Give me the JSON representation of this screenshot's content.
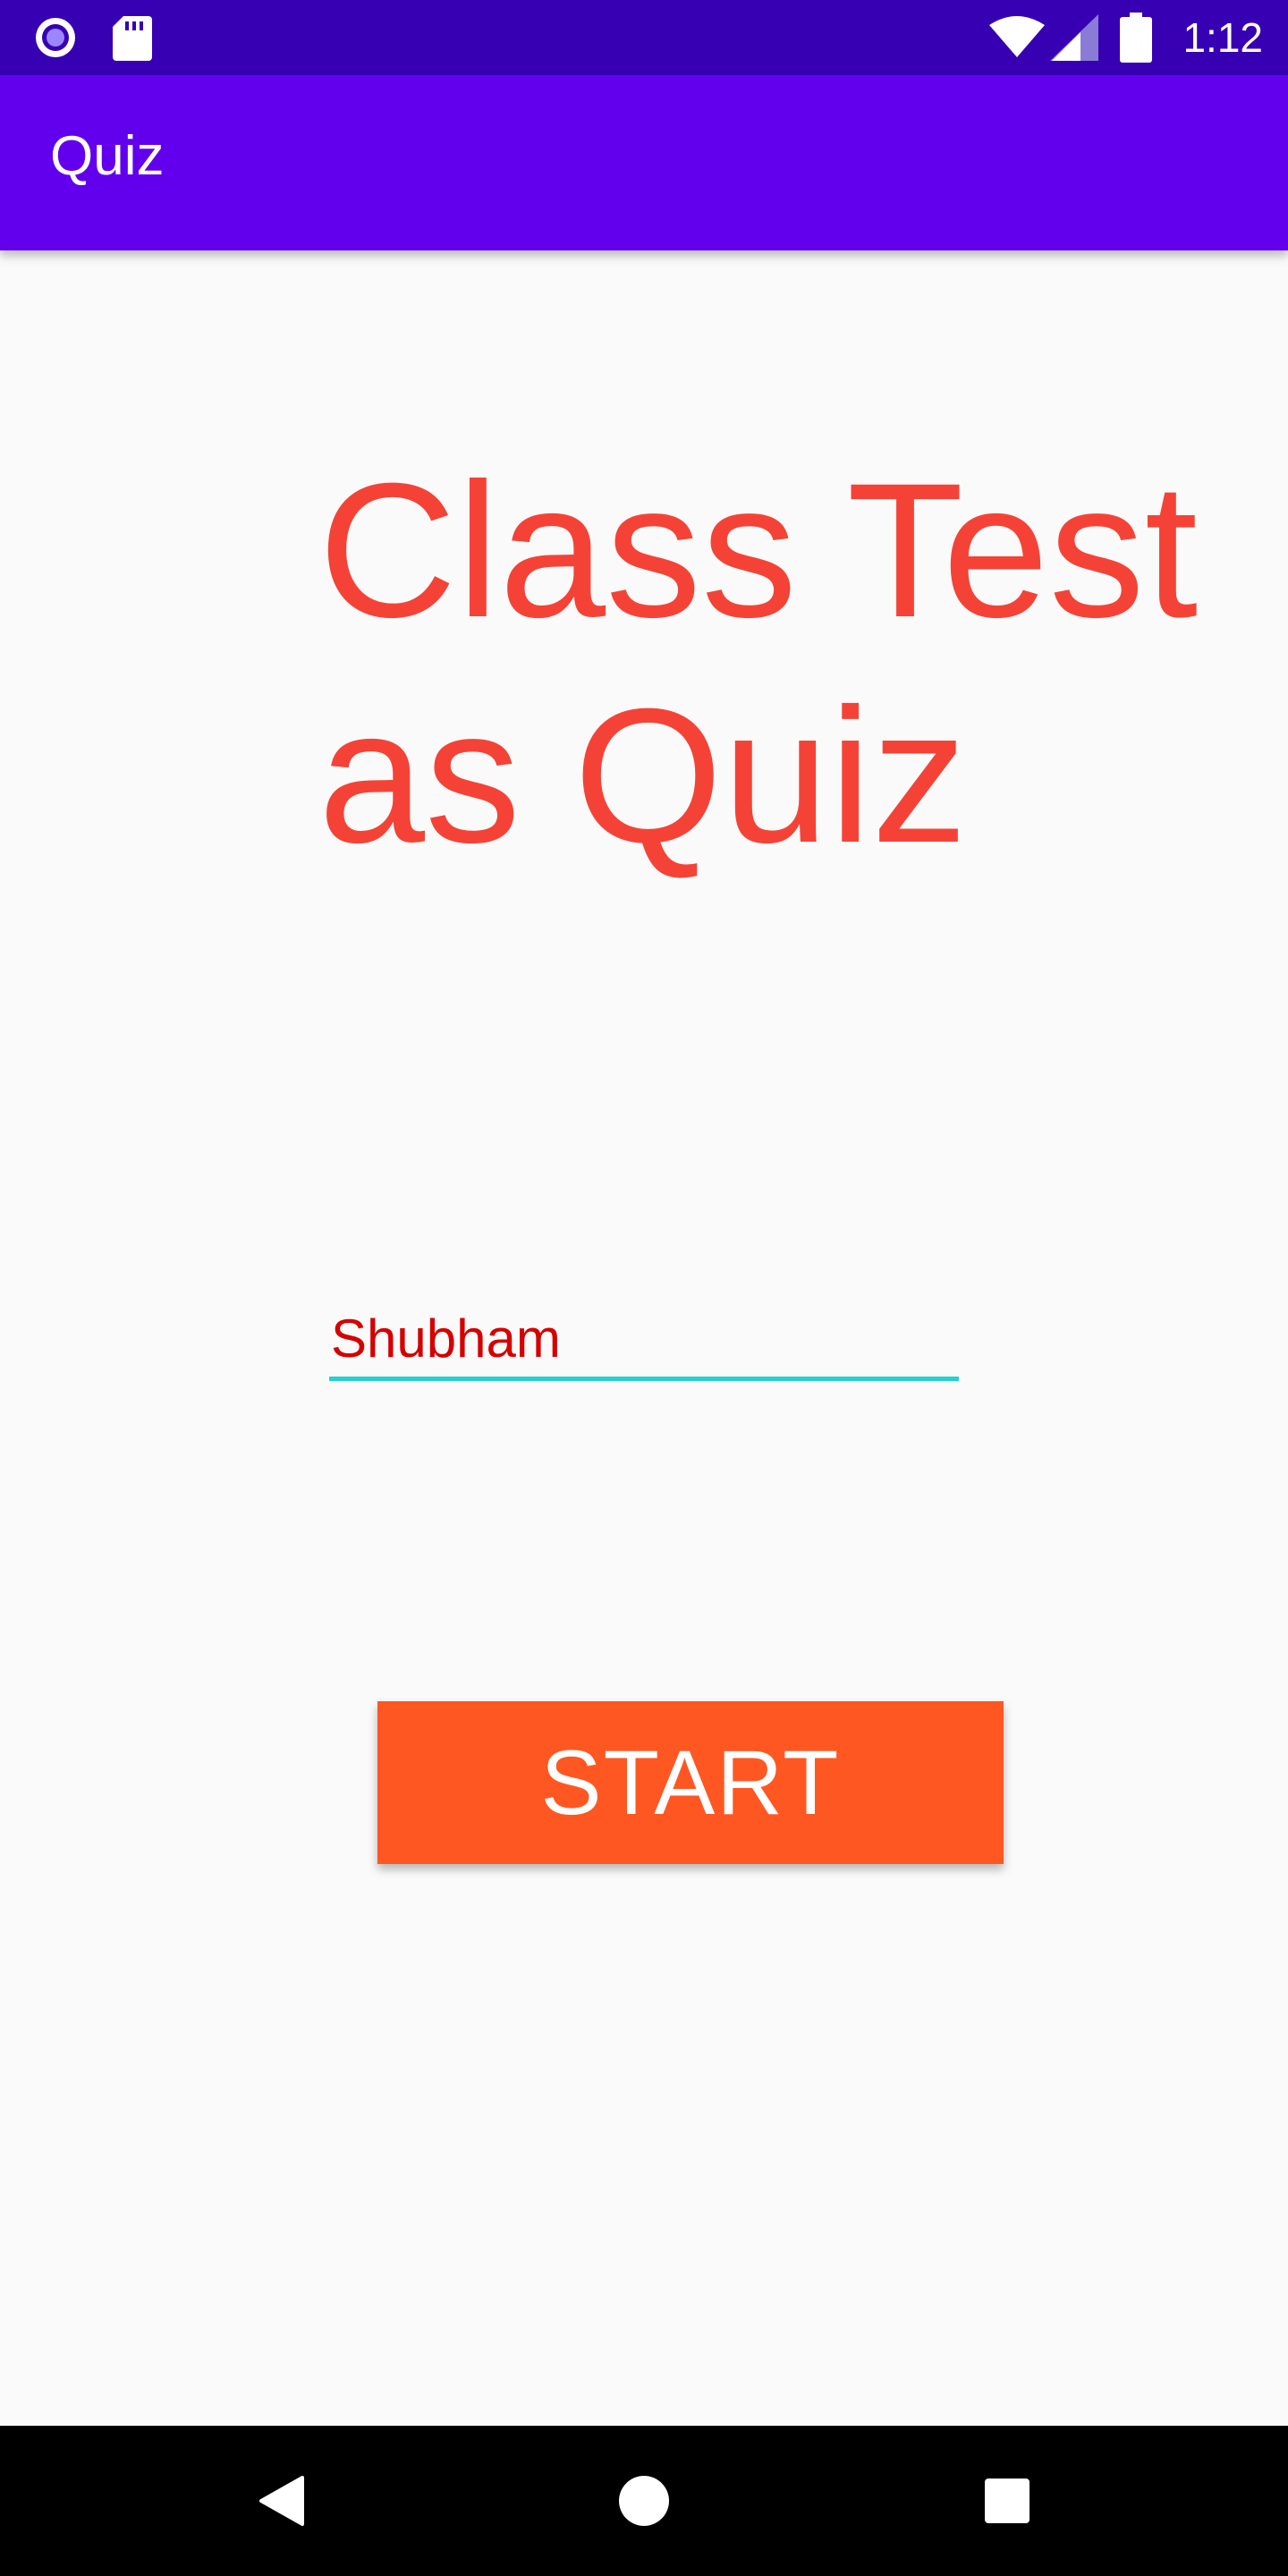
{
  "status_bar": {
    "time": "1:12",
    "icons": [
      "notification-circle-icon",
      "sd-card-icon",
      "wifi-icon",
      "cell-signal-icon",
      "battery-icon"
    ]
  },
  "app_bar": {
    "title": "Quiz"
  },
  "main": {
    "headline": "Class Test as Quiz",
    "name_input": {
      "value": "Shubham"
    },
    "start_label": "START"
  },
  "nav_bar": {
    "icons": [
      "back-icon",
      "home-icon",
      "recents-icon"
    ]
  },
  "colors": {
    "status_bar": "#3700b3",
    "app_bar": "#6200ee",
    "headline": "#f44336",
    "input_text": "#d50000",
    "input_underline": "#26d0ce",
    "button": "#ff5722",
    "background": "#fafafa"
  }
}
